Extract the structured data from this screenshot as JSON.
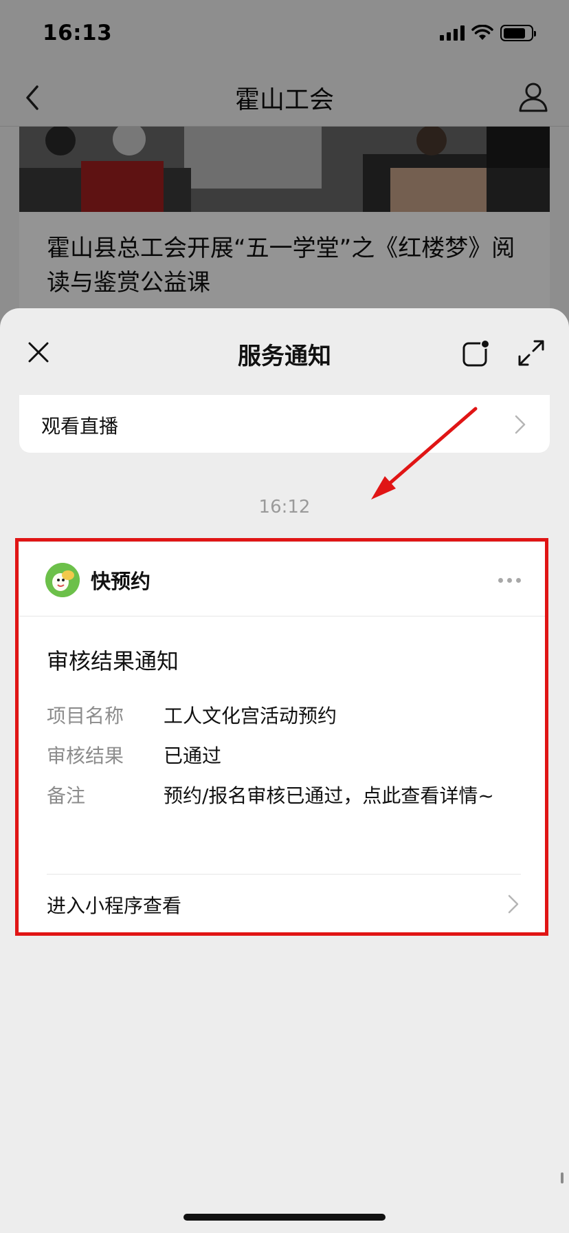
{
  "status_bar": {
    "time": "16:13",
    "battery_level": 0.8
  },
  "background_page": {
    "nav_title": "霍山工会",
    "back_icon": "chevron-left-icon",
    "user_icon": "user-icon",
    "article_title": "霍山县总工会开展“五一学堂”之《红楼梦》阅读与鉴赏公益课"
  },
  "sheet": {
    "title": "服务通知",
    "close_icon": "close-icon",
    "float_icon": "floating-window-icon",
    "expand_icon": "expand-icon",
    "live_card": {
      "label": "观看直播"
    },
    "timestamp": "16:12"
  },
  "notice": {
    "app_name": "快预约",
    "title": "审核结果通知",
    "fields": [
      {
        "key": "项目名称",
        "value": "工人文化宫活动预约"
      },
      {
        "key": "审核结果",
        "value": "已通过"
      },
      {
        "key": "备注",
        "value": "预约/报名审核已通过，点此查看详情~"
      }
    ],
    "footer_label": "进入小程序查看"
  },
  "colors": {
    "highlight": "#e01515",
    "arrow": "#e01515",
    "avatar_green": "#6cc04a"
  }
}
